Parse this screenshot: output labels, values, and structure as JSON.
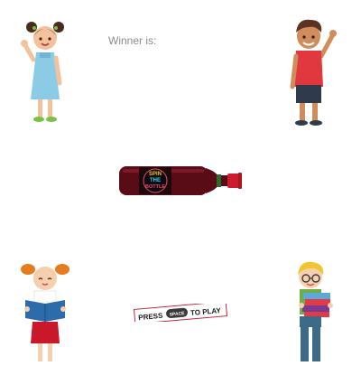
{
  "status": {
    "winner_label": "Winner is:",
    "winner_name": ""
  },
  "bottle": {
    "label_line1": "SPIN",
    "label_line2": "THE",
    "label_line3": "BOTTLE",
    "glass_color": "#5a0c16",
    "cap_color": "#c91c2e"
  },
  "start_prompt": {
    "press": "PRESS",
    "key": "SPACE",
    "to_play": "TO PLAY"
  },
  "players": [
    {
      "character": "girl-waving-icon"
    },
    {
      "character": "boy-waving-icon"
    },
    {
      "character": "girl-reading-book-icon"
    },
    {
      "character": "boy-carrying-books-icon"
    }
  ]
}
